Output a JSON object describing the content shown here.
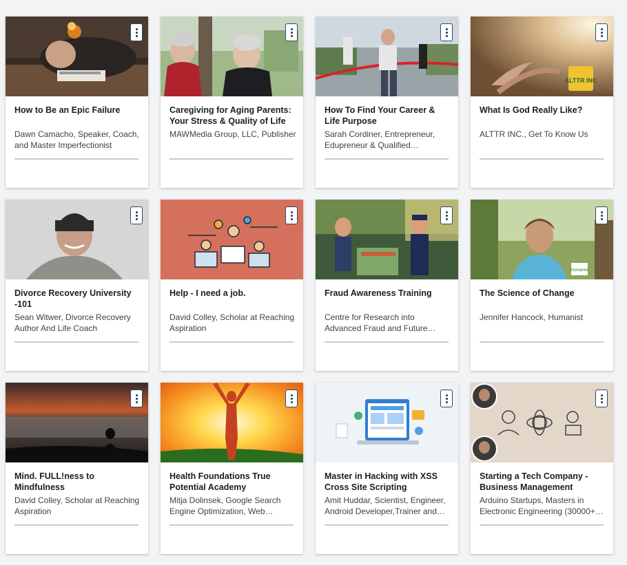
{
  "courses": [
    {
      "title": "How to Be an Epic Failure",
      "author": "Dawn Camacho, Speaker, Coach, and Master Imperfectionist"
    },
    {
      "title": "Caregiving for Aging Parents: Your Stress & Quality of Life",
      "author": "MAWMedia Group, LLC, Publisher"
    },
    {
      "title": "How To Find Your Career & Life Purpose",
      "author": "Sarah Cordiner, Entrepreneur, Edupreneur & Qualified…"
    },
    {
      "title": "What Is God Really Like?",
      "author": "ALTTR INC., Get To Know Us"
    },
    {
      "title": "Divorce Recovery University -101",
      "author": "Sean Witwer, Divorce Recovery Author And Life Coach"
    },
    {
      "title": "Help - I need a job.",
      "author": "David Colley, Scholar at Reaching Aspiration"
    },
    {
      "title": "Fraud Awareness Training",
      "author": "Centre for Research into Advanced Fraud and Future…"
    },
    {
      "title": "The Science of Change",
      "author": "Jennifer Hancock, Humanist"
    },
    {
      "title": "Mind. FULL!ness to Mindfulness",
      "author": "David Colley, Scholar at Reaching Aspiration"
    },
    {
      "title": "Health Foundations True Potential Academy",
      "author": "Mitja Dolinsek, Google Search Engine Optimization, Web…"
    },
    {
      "title": "Master in Hacking with XSS Cross Site Scripting",
      "author": "Amit Huddar, Scientist, Engineer, Android Developer,Trainer and…"
    },
    {
      "title": "Starting a Tech Company - Business Management",
      "author": "Arduino Startups, Masters in Electronic Engineering (30000+…"
    }
  ],
  "logos": {
    "alttr": "ALTTR INC",
    "humanist": "Humanist"
  },
  "icons": {
    "menu": "kebab-menu-icon"
  }
}
